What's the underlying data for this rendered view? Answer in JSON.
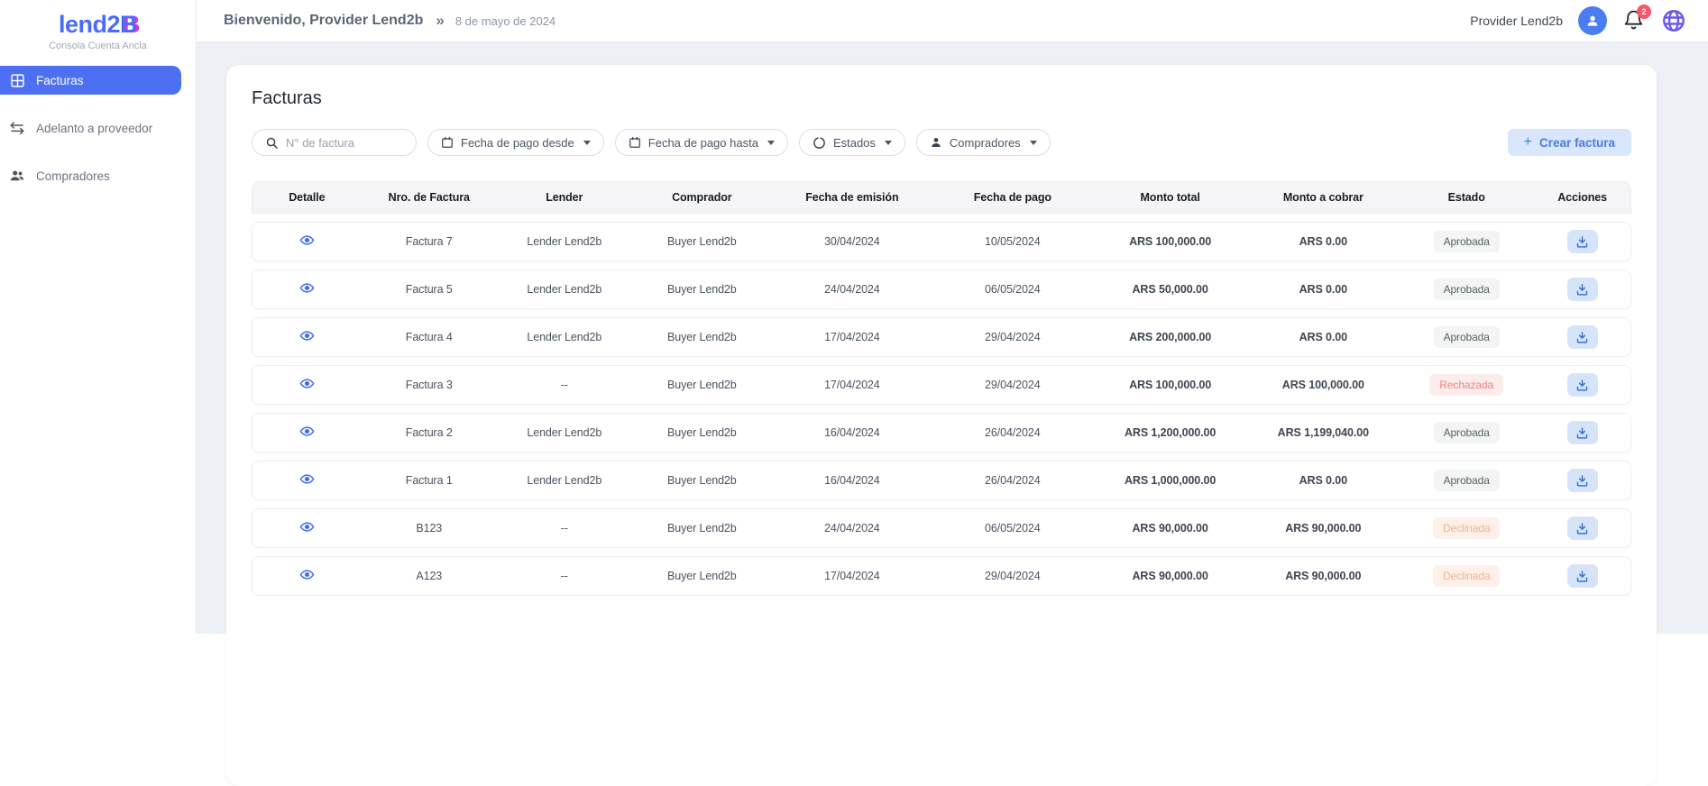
{
  "sidebar": {
    "logo_part1": "lend2",
    "logo_part2": "B",
    "subtitle": "Consola Cuenta Ancla",
    "items": [
      {
        "label": "Facturas",
        "icon": "grid-icon",
        "active": true
      },
      {
        "label": "Adelanto a proveedor",
        "icon": "transfer-icon",
        "active": false
      },
      {
        "label": "Compradores",
        "icon": "people-icon",
        "active": false
      }
    ]
  },
  "header": {
    "welcome": "Bienvenido, Provider Lend2b",
    "separator": "»",
    "date": "8 de mayo de 2024",
    "user_name": "Provider Lend2b",
    "notification_count": "2"
  },
  "main": {
    "title": "Facturas",
    "filters": {
      "search_placeholder": "N° de factura",
      "date_from_label": "Fecha de pago desde",
      "date_to_label": "Fecha de pago hasta",
      "states_label": "Estados",
      "buyers_label": "Compradores",
      "create_plus": "+",
      "create_label": "Crear factura"
    },
    "table": {
      "headers": [
        "Detalle",
        "Nro. de Factura",
        "Lender",
        "Comprador",
        "Fecha de emisión",
        "Fecha de pago",
        "Monto total",
        "Monto a cobrar",
        "Estado",
        "Acciones"
      ],
      "rows": [
        {
          "invoice": "Factura 7",
          "lender": "Lender Lend2b",
          "buyer": "Buyer Lend2b",
          "issue_date": "30/04/2024",
          "payment_date": "10/05/2024",
          "total": "ARS 100,000.00",
          "receivable": "ARS 0.00",
          "status": "Aprobada",
          "status_type": "approved"
        },
        {
          "invoice": "Factura 5",
          "lender": "Lender Lend2b",
          "buyer": "Buyer Lend2b",
          "issue_date": "24/04/2024",
          "payment_date": "06/05/2024",
          "total": "ARS 50,000.00",
          "receivable": "ARS 0.00",
          "status": "Aprobada",
          "status_type": "approved"
        },
        {
          "invoice": "Factura 4",
          "lender": "Lender Lend2b",
          "buyer": "Buyer Lend2b",
          "issue_date": "17/04/2024",
          "payment_date": "29/04/2024",
          "total": "ARS 200,000.00",
          "receivable": "ARS 0.00",
          "status": "Aprobada",
          "status_type": "approved"
        },
        {
          "invoice": "Factura 3",
          "lender": "--",
          "buyer": "Buyer Lend2b",
          "issue_date": "17/04/2024",
          "payment_date": "29/04/2024",
          "total": "ARS 100,000.00",
          "receivable": "ARS 100,000.00",
          "status": "Rechazada",
          "status_type": "rejected"
        },
        {
          "invoice": "Factura 2",
          "lender": "Lender Lend2b",
          "buyer": "Buyer Lend2b",
          "issue_date": "16/04/2024",
          "payment_date": "26/04/2024",
          "total": "ARS 1,200,000.00",
          "receivable": "ARS 1,199,040.00",
          "status": "Aprobada",
          "status_type": "approved"
        },
        {
          "invoice": "Factura 1",
          "lender": "Lender Lend2b",
          "buyer": "Buyer Lend2b",
          "issue_date": "16/04/2024",
          "payment_date": "26/04/2024",
          "total": "ARS 1,000,000.00",
          "receivable": "ARS 0.00",
          "status": "Aprobada",
          "status_type": "approved"
        },
        {
          "invoice": "B123",
          "lender": "--",
          "buyer": "Buyer Lend2b",
          "issue_date": "24/04/2024",
          "payment_date": "06/05/2024",
          "total": "ARS 90,000.00",
          "receivable": "ARS 90,000.00",
          "status": "Declinada",
          "status_type": "declined"
        },
        {
          "invoice": "A123",
          "lender": "--",
          "buyer": "Buyer Lend2b",
          "issue_date": "17/04/2024",
          "payment_date": "29/04/2024",
          "total": "ARS 90,000.00",
          "receivable": "ARS 90,000.00",
          "status": "Declinada",
          "status_type": "declined"
        }
      ]
    }
  },
  "colors": {
    "accent_blue": "#4a6cf8",
    "logo_magenta": "#d435e2",
    "active_nav_bg": "#4d70f3",
    "create_btn_bg": "#d9e6fc",
    "create_btn_text": "#4a7be0",
    "badge_approved_bg": "#f2f5f3",
    "badge_approved_text": "#5a645e",
    "badge_rejected_bg": "#fdecec",
    "badge_rejected_text": "#f47f7f",
    "badge_declined_bg": "#fcf0e8",
    "badge_declined_text": "#f3b38c",
    "notification_badge": "#f6576a",
    "globe_purple": "#6a5ae8",
    "content_bg": "#edf0f5"
  }
}
